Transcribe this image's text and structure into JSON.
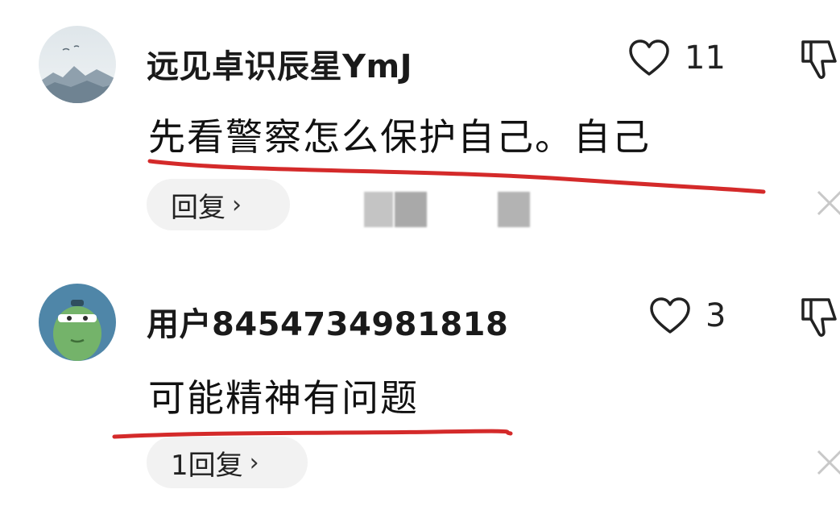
{
  "comments": [
    {
      "username": "远见卓识辰星YmJ",
      "text": "先看警察怎么保护自己。自己",
      "likes": "11",
      "reply_label": "回复",
      "avatar_icon": "landscape-avatar-icon"
    },
    {
      "username": "用户8454734981818",
      "text": "可能精神有问题",
      "likes": "3",
      "reply_label": "1回复",
      "avatar_icon": "green-creature-avatar-icon"
    }
  ],
  "colors": {
    "annotation_underline": "#d42a2a",
    "reply_pill": "#f2f2f2",
    "icon_stroke": "#222222"
  }
}
